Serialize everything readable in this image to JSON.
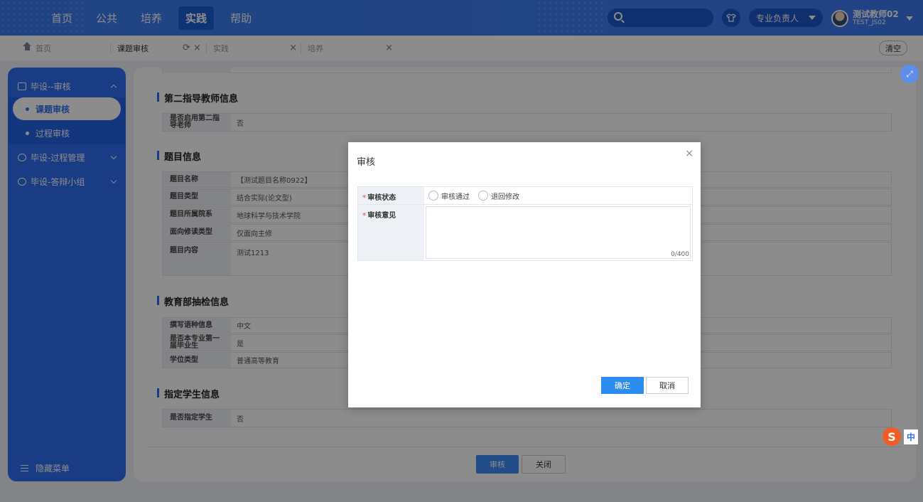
{
  "topnav": {
    "items": [
      "首页",
      "公共",
      "培养",
      "实践",
      "帮助"
    ],
    "active": "实践",
    "role": "专业负责人",
    "user_name": "测试教师02",
    "user_code": "TEST_JS02"
  },
  "tabs": {
    "home": "首页",
    "items": [
      "课题审核",
      "实践",
      "培养"
    ],
    "clear": "清空"
  },
  "sidebar": {
    "groups": [
      "毕设--审核",
      "毕设-过程管理",
      "毕设-答辩小组"
    ],
    "subitems": [
      "课题审核",
      "过程审核"
    ],
    "hide_menu": "隐藏菜单"
  },
  "content": {
    "sec_second_teacher": "第二指导教师信息",
    "second_teacher_label": "是否启用第二指导老师",
    "second_teacher_value": "否",
    "sec_topic": "题目信息",
    "topic_rows": [
      {
        "label": "题目名称",
        "value": "【测试题目名称0922】"
      },
      {
        "label": "题目类型",
        "value": "结合实际(论文型)"
      },
      {
        "label": "题目所属院系",
        "value": "地球科学与技术学院"
      },
      {
        "label": "面向修读类型",
        "value": "仅面向主修"
      },
      {
        "label": "题目内容",
        "value": "测试1213"
      }
    ],
    "sec_moe": "教育部抽检信息",
    "moe_rows": [
      {
        "label": "撰写语种信息",
        "value": "中文"
      },
      {
        "label": "是否本专业第一届毕业生",
        "value": "是"
      },
      {
        "label": "学位类型",
        "value": "普通高等教育"
      }
    ],
    "sec_student": "指定学生信息",
    "student_label": "是否指定学生",
    "student_value": "否",
    "btn_review": "审核",
    "btn_close": "关闭"
  },
  "dialog": {
    "title": "审核",
    "status_label": "审核状态",
    "opinion_label": "审核意见",
    "option_pass": "审核通过",
    "option_return": "退回修改",
    "counter": "0/400",
    "confirm": "确定",
    "cancel": "取消"
  },
  "ime": {
    "label": "中"
  }
}
